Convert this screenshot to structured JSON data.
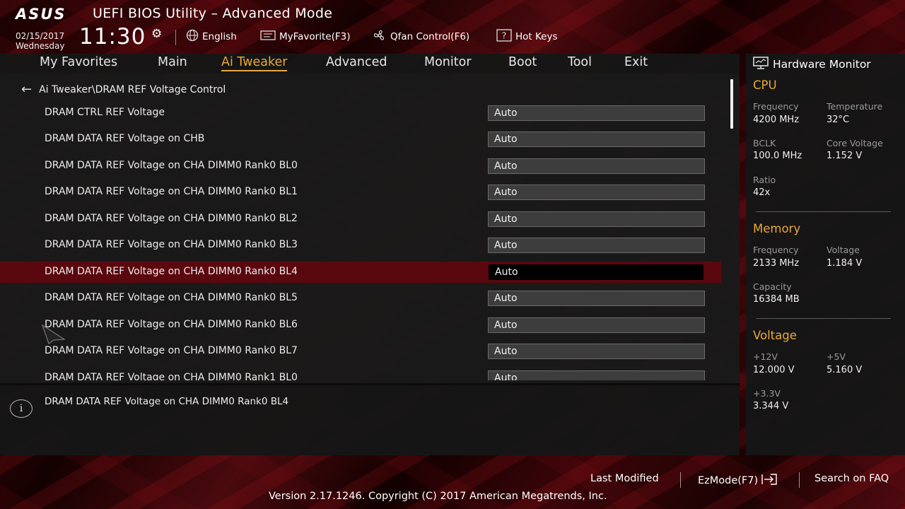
{
  "header": {
    "logo": "ASUS",
    "title": "UEFI BIOS Utility – Advanced Mode",
    "date": "02/15/2017",
    "day": "Wednesday",
    "time": "11:30",
    "language": "English",
    "favorite": "MyFavorite(F3)",
    "qfan": "Qfan Control(F6)",
    "hotkeys": "Hot Keys"
  },
  "menu": {
    "items": [
      "My Favorites",
      "Main",
      "Ai Tweaker",
      "Advanced",
      "Monitor",
      "Boot",
      "Tool",
      "Exit"
    ],
    "active": "Ai Tweaker"
  },
  "breadcrumb": "Ai Tweaker\\DRAM REF Voltage Control",
  "rows": [
    {
      "label": "DRAM CTRL REF Voltage",
      "value": "Auto"
    },
    {
      "label": "DRAM DATA REF Voltage on CHB",
      "value": "Auto"
    },
    {
      "label": "DRAM DATA REF Voltage on CHA DIMM0 Rank0 BL0",
      "value": "Auto"
    },
    {
      "label": "DRAM DATA REF Voltage on CHA DIMM0 Rank0 BL1",
      "value": "Auto"
    },
    {
      "label": "DRAM DATA REF Voltage on CHA DIMM0 Rank0 BL2",
      "value": "Auto"
    },
    {
      "label": "DRAM DATA REF Voltage on CHA DIMM0 Rank0 BL3",
      "value": "Auto"
    },
    {
      "label": "DRAM DATA REF Voltage on CHA DIMM0 Rank0 BL4",
      "value": "Auto"
    },
    {
      "label": "DRAM DATA REF Voltage on CHA DIMM0 Rank0 BL5",
      "value": "Auto"
    },
    {
      "label": "DRAM DATA REF Voltage on CHA DIMM0 Rank0 BL6",
      "value": "Auto"
    },
    {
      "label": "DRAM DATA REF Voltage on CHA DIMM0 Rank0 BL7",
      "value": "Auto"
    },
    {
      "label": "DRAM DATA REF Voltage on CHA DIMM0 Rank1 BL0",
      "value": "Auto"
    }
  ],
  "selected_row": "DRAM DATA REF Voltage on CHA DIMM0 Rank0 BL4",
  "help_text": "DRAM DATA REF Voltage on CHA DIMM0 Rank0 BL4",
  "hardware_monitor": {
    "title": "Hardware Monitor",
    "cpu": {
      "heading": "CPU",
      "frequency_label": "Frequency",
      "frequency": "4200 MHz",
      "temperature_label": "Temperature",
      "temperature": "32°C",
      "bclk_label": "BCLK",
      "bclk": "100.0 MHz",
      "core_voltage_label": "Core Voltage",
      "core_voltage": "1.152 V",
      "ratio_label": "Ratio",
      "ratio": "42x"
    },
    "memory": {
      "heading": "Memory",
      "frequency_label": "Frequency",
      "frequency": "2133 MHz",
      "voltage_label": "Voltage",
      "voltage": "1.184 V",
      "capacity_label": "Capacity",
      "capacity": "16384 MB"
    },
    "voltage": {
      "heading": "Voltage",
      "v12_label": "+12V",
      "v12": "12.000 V",
      "v5_label": "+5V",
      "v5": "5.160 V",
      "v33_label": "+3.3V",
      "v33": "3.344 V"
    }
  },
  "footer": {
    "last_modified": "Last Modified",
    "ezmode": "EzMode(F7)",
    "search": "Search on FAQ",
    "version": "Version 2.17.1246. Copyright (C) 2017 American Megatrends, Inc."
  },
  "colors": {
    "accent": "#e8a93a",
    "selected_row": "#5a070e",
    "panel": "#1a1a1a"
  }
}
